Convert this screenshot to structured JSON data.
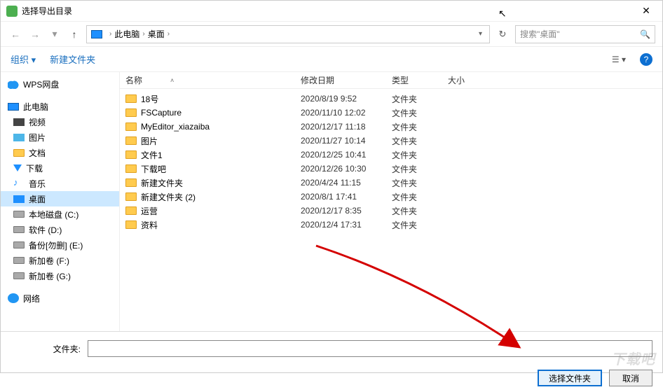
{
  "window": {
    "title": "选择导出目录",
    "close": "✕"
  },
  "nav": {
    "back": "←",
    "fwd": "→",
    "recent": "▾",
    "up": "↑",
    "crumb1": "此电脑",
    "crumb2": "桌面",
    "sep": "›",
    "drop": "▾",
    "refresh": "↻"
  },
  "search": {
    "placeholder": "搜索\"桌面\""
  },
  "toolbar": {
    "org": "组织 ▾",
    "newfolder": "新建文件夹",
    "view": "☰ ▾",
    "help": "?"
  },
  "sidebar": {
    "wps": "WPS网盘",
    "thispc": "此电脑",
    "items": [
      {
        "icon": "video",
        "label": "视频"
      },
      {
        "icon": "pic",
        "label": "图片"
      },
      {
        "icon": "folder",
        "label": "文档"
      },
      {
        "icon": "down",
        "label": "下载"
      },
      {
        "icon": "music",
        "label": "音乐",
        "glyph": "♪"
      },
      {
        "icon": "desk",
        "label": "桌面",
        "selected": true
      },
      {
        "icon": "drive",
        "label": "本地磁盘 (C:)"
      },
      {
        "icon": "drive",
        "label": "软件 (D:)"
      },
      {
        "icon": "drive",
        "label": "备份[勿删] (E:)"
      },
      {
        "icon": "drive",
        "label": "新加卷 (F:)"
      },
      {
        "icon": "drive",
        "label": "新加卷 (G:)"
      }
    ],
    "network": "网络"
  },
  "columns": {
    "name": "名称",
    "date": "修改日期",
    "type": "类型",
    "size": "大小",
    "sort": "˄"
  },
  "files": [
    {
      "name": "18号",
      "date": "2020/8/19 9:52",
      "type": "文件夹"
    },
    {
      "name": "FSCapture",
      "date": "2020/11/10 12:02",
      "type": "文件夹"
    },
    {
      "name": "MyEditor_xiazaiba",
      "date": "2020/12/17 11:18",
      "type": "文件夹"
    },
    {
      "name": "图片",
      "date": "2020/11/27 10:14",
      "type": "文件夹"
    },
    {
      "name": "文件1",
      "date": "2020/12/25 10:41",
      "type": "文件夹"
    },
    {
      "name": "下载吧",
      "date": "2020/12/26 10:30",
      "type": "文件夹"
    },
    {
      "name": "新建文件夹",
      "date": "2020/4/24 11:15",
      "type": "文件夹"
    },
    {
      "name": "新建文件夹 (2)",
      "date": "2020/8/1 17:41",
      "type": "文件夹"
    },
    {
      "name": "运营",
      "date": "2020/12/17 8:35",
      "type": "文件夹"
    },
    {
      "name": "资料",
      "date": "2020/12/4 17:31",
      "type": "文件夹"
    }
  ],
  "bottom": {
    "label": "文件夹:",
    "value": "",
    "select": "选择文件夹",
    "cancel": "取消"
  },
  "watermark": "下载吧"
}
